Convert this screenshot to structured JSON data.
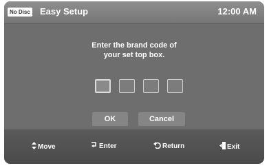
{
  "header": {
    "disc_status": "No Disc",
    "title": "Easy Setup",
    "time": "12:00 AM"
  },
  "content": {
    "prompt_line1": "Enter the brand code of",
    "prompt_line2": "your set top box.",
    "code_digits": [
      "",
      "",
      "",
      ""
    ]
  },
  "buttons": {
    "ok_label": "OK",
    "cancel_label": "Cancel"
  },
  "footer": {
    "move_label": "Move",
    "enter_label": "Enter",
    "return_label": "Return",
    "exit_label": "Exit",
    "icons": {
      "move": "up-down-arrows-icon",
      "enter": "enter-icon",
      "return": "return-arrow-icon",
      "exit": "exit-icon"
    }
  },
  "colors": {
    "panel": "#6e6e6e",
    "header": "#808080",
    "footer": "#505050",
    "text": "#ffffff"
  }
}
